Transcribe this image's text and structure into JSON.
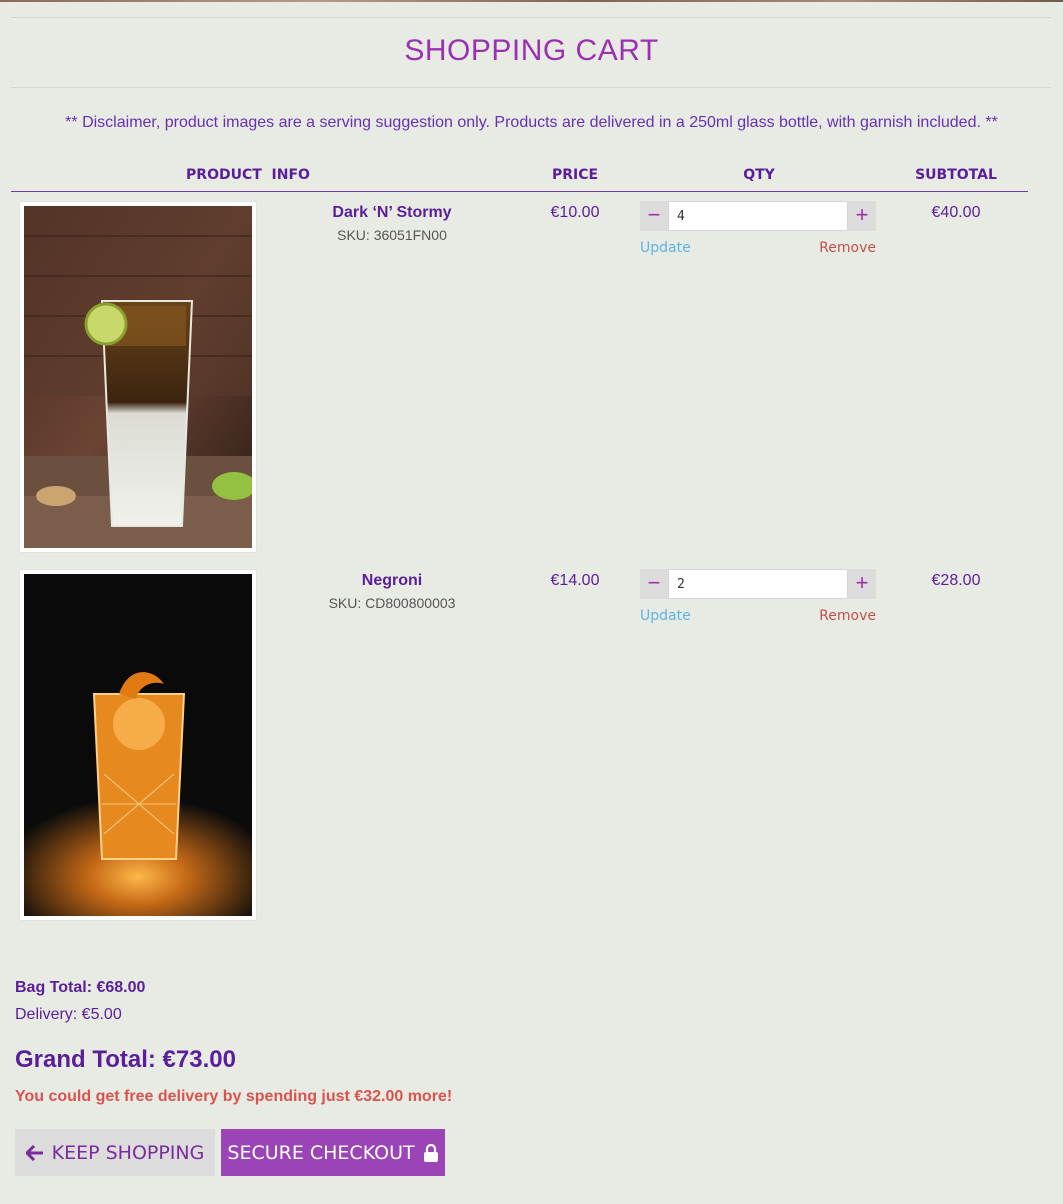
{
  "page": {
    "title": "SHOPPING CART"
  },
  "disclaimer": "** Disclaimer, product images are a serving suggestion only. Products are delivered in a 250ml glass bottle, with garnish included. **",
  "table_headers": {
    "product_info": "PRODUCT  INFO",
    "price": "PRICE",
    "qty": "QTY",
    "subtotal": "SUBTOTAL"
  },
  "items": [
    {
      "name": "Dark ‘N’ Stormy",
      "sku": "SKU: 36051FN00",
      "price": "€10.00",
      "qty": "4",
      "subtotal": "€40.00",
      "update_label": "Update",
      "remove_label": "Remove",
      "minus_label": "−",
      "plus_label": "+"
    },
    {
      "name": "Negroni",
      "sku": "SKU: CD800800003",
      "price": "€14.00",
      "qty": "2",
      "subtotal": "€28.00",
      "update_label": "Update",
      "remove_label": "Remove",
      "minus_label": "−",
      "plus_label": "+"
    }
  ],
  "totals": {
    "bag_total": "Bag Total: €68.00",
    "delivery": "Delivery: €5.00",
    "grand_total": "Grand Total: €73.00",
    "free_delivery_note": "You could get free delivery by spending just €32.00 more!"
  },
  "buttons": {
    "keep_shopping": "KEEP SHOPPING",
    "secure_checkout": "SECURE CHECKOUT"
  },
  "icons": {
    "keep_shopping": "arrow-left-icon",
    "secure_checkout": "lock-icon"
  },
  "colors": {
    "brand_purple": "#5b1e9b",
    "title_purple": "#9a31b1",
    "checkout_bg": "#9a44b5",
    "warning_red": "#d9534f",
    "update_blue": "#5cb3e6"
  }
}
